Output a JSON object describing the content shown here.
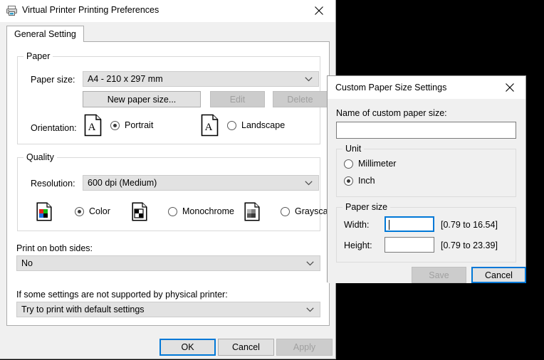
{
  "main_window": {
    "title": "Virtual Printer Printing Preferences",
    "icon": "printer-icon",
    "close_glyph": "✕",
    "tabs": [
      {
        "label": "General Setting",
        "selected": true
      }
    ],
    "paper_group": {
      "title": "Paper",
      "paper_size_label": "Paper size:",
      "paper_size_value": "A4 - 210 x 297 mm",
      "new_paper_size_button": "New paper size...",
      "edit_button": "Edit",
      "delete_button": "Delete",
      "orientation_label": "Orientation:",
      "orientation_options": [
        {
          "label": "Portrait",
          "checked": true,
          "icon": "page-portrait-icon"
        },
        {
          "label": "Landscape",
          "checked": false,
          "icon": "page-landscape-icon"
        }
      ]
    },
    "quality_group": {
      "title": "Quality",
      "resolution_label": "Resolution:",
      "resolution_value": "600 dpi (Medium)",
      "color_options": [
        {
          "label": "Color",
          "checked": true,
          "icon": "color-page-icon"
        },
        {
          "label": "Monochrome",
          "checked": false,
          "icon": "monochrome-page-icon"
        },
        {
          "label": "Grayscale",
          "checked": false,
          "icon": "grayscale-page-icon"
        }
      ]
    },
    "duplex_label": "Print on both sides:",
    "duplex_value": "No",
    "fallback_label": "If some settings are not supported by physical printer:",
    "fallback_value": "Try to print with default settings",
    "footer_buttons": {
      "ok": "OK",
      "cancel": "Cancel",
      "apply": "Apply",
      "apply_disabled": true,
      "ok_focused": true
    }
  },
  "dialog": {
    "title": "Custom Paper Size Settings",
    "close_glyph": "✕",
    "name_label": "Name of custom paper size:",
    "name_value": "",
    "name_placeholder": "",
    "unit_group": {
      "title": "Unit",
      "options": [
        {
          "label": "Millimeter",
          "checked": false
        },
        {
          "label": "Inch",
          "checked": true
        }
      ]
    },
    "paper_size_group": {
      "title": "Paper size",
      "width_label": "Width:",
      "width_value": "",
      "width_range": "[0.79 to 16.54]",
      "width_focused": true,
      "height_label": "Height:",
      "height_value": "",
      "height_range": "[0.79 to 23.39]"
    },
    "buttons": {
      "save": "Save",
      "save_disabled": true,
      "cancel": "Cancel",
      "cancel_focused": true
    }
  },
  "colors": {
    "accent": "#0078d7",
    "window_bg": "#f0f0f0",
    "pane_bg": "#ffffff",
    "desktop_bg": "#000000",
    "control_bg": "#e1e1e1",
    "combo_bg": "#e2e2e2",
    "disabled_text": "#a0a0a0"
  }
}
